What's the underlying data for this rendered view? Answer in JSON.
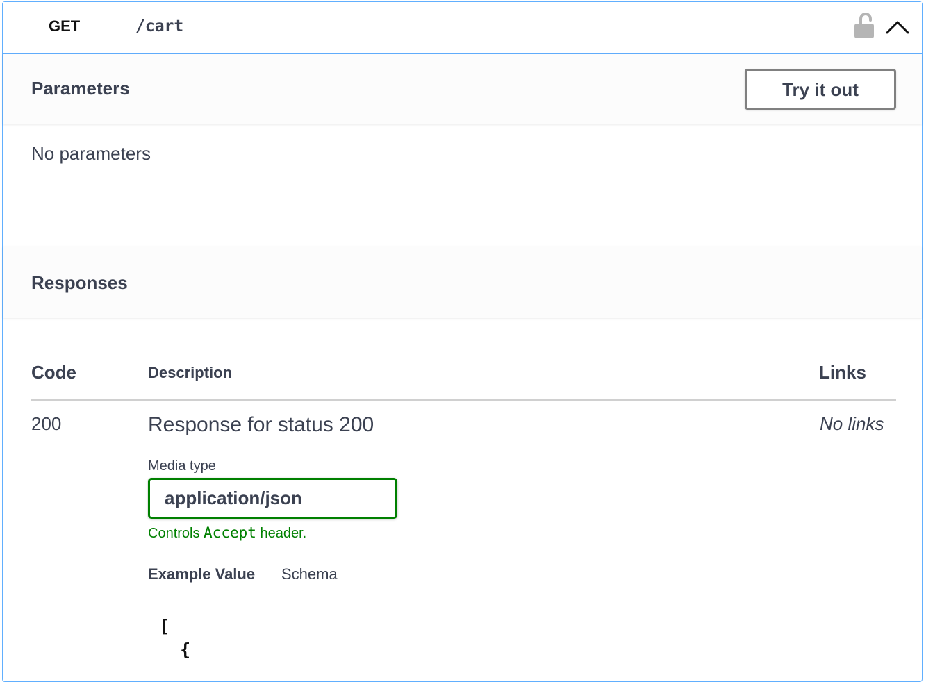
{
  "operation": {
    "method": "GET",
    "path": "/cart"
  },
  "icons": {
    "lock": "unlocked-padlock-icon",
    "collapse": "chevron-up-icon"
  },
  "parameters": {
    "title": "Parameters",
    "try_button_label": "Try it out",
    "empty_text": "No parameters"
  },
  "responses": {
    "title": "Responses",
    "columns": {
      "code": "Code",
      "description": "Description",
      "links": "Links"
    },
    "rows": [
      {
        "code": "200",
        "description": "Response for status 200",
        "links": "No links",
        "media_type_label": "Media type",
        "media_type_value": "application/json",
        "controls_prefix": "Controls ",
        "controls_code": "Accept",
        "controls_suffix": " header.",
        "tabs": [
          "Example Value",
          "Schema"
        ],
        "example_lines": [
          "[",
          "  {"
        ]
      }
    ]
  },
  "colors": {
    "get_accent": "#61affe",
    "media_select_border": "#008000",
    "text": "#3b4151"
  }
}
